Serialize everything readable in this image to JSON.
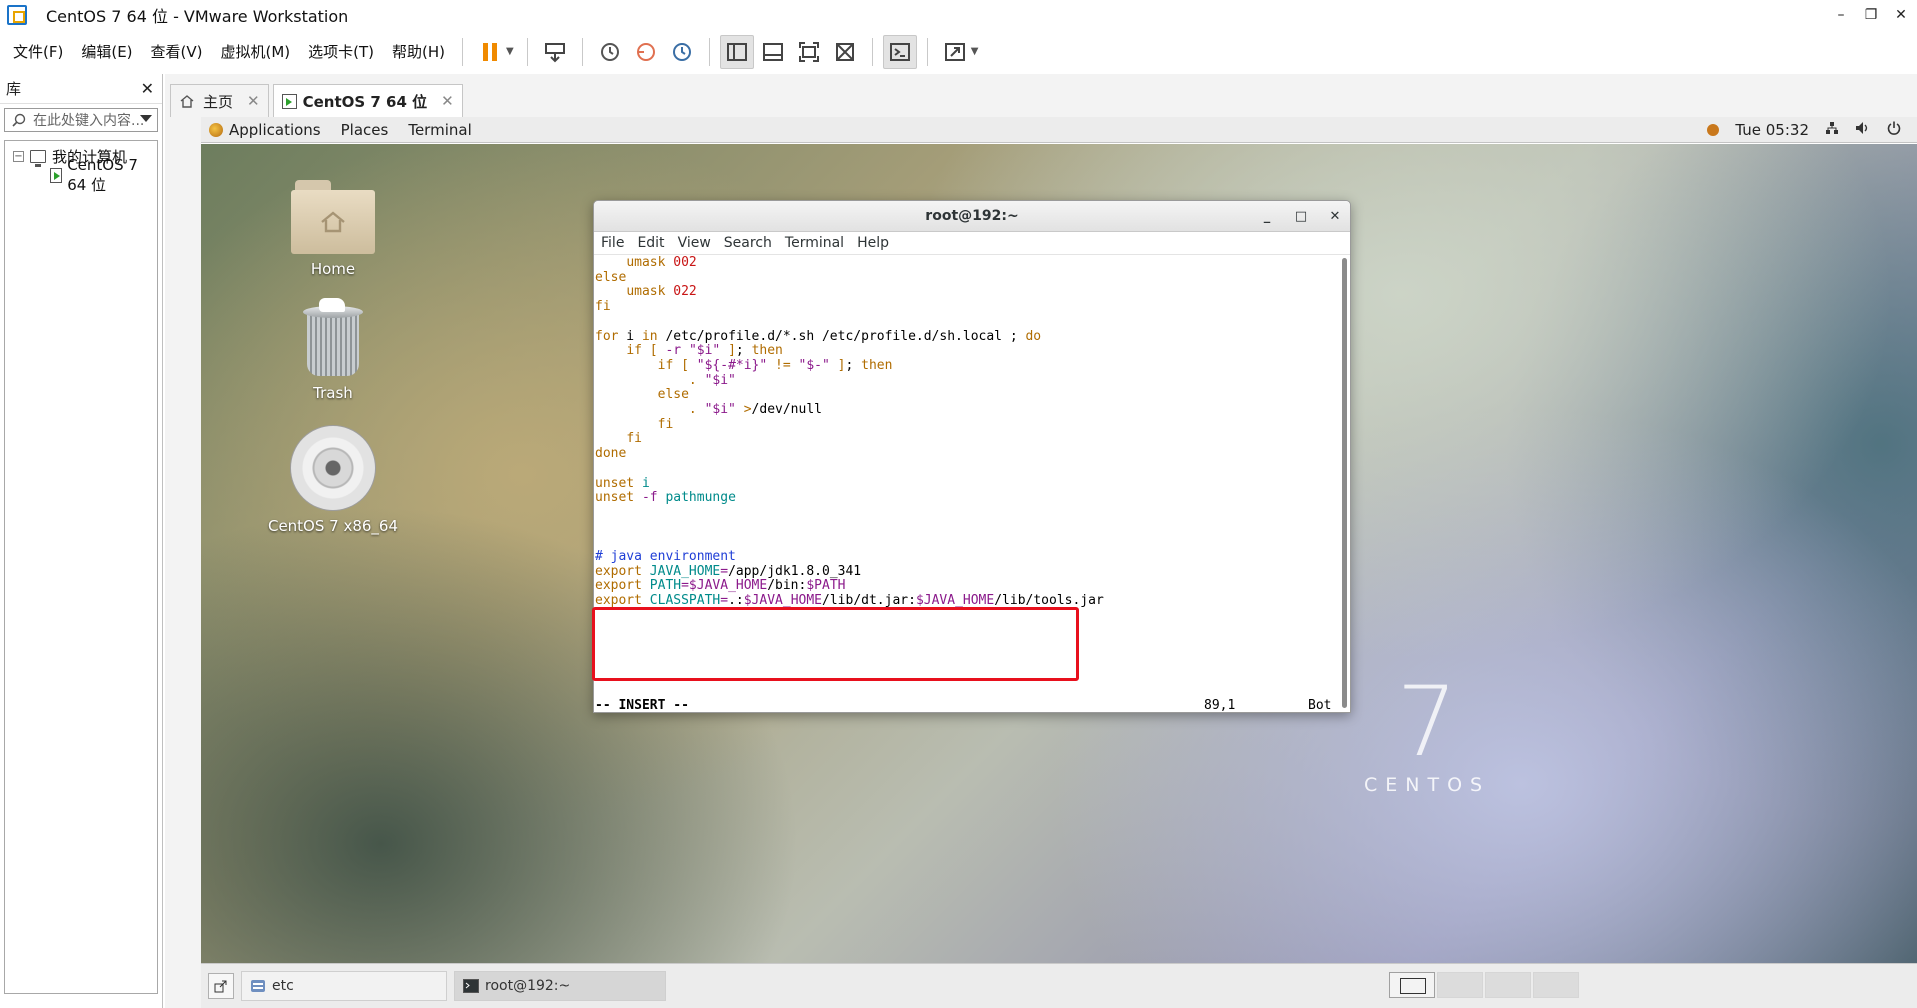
{
  "window": {
    "title": "CentOS 7 64 位 - VMware Workstation",
    "minimize": "–",
    "restore": "❐",
    "close": "✕"
  },
  "menu": {
    "items": [
      "文件(F)",
      "编辑(E)",
      "查看(V)",
      "虚拟机(M)",
      "选项卡(T)",
      "帮助(H)"
    ]
  },
  "library": {
    "title": "库",
    "close": "✕",
    "search_placeholder": "在此处键入内容...",
    "tree": {
      "root_label": "我的计算机",
      "toggle": "−",
      "vm_label": "CentOS 7 64 位"
    }
  },
  "tabs": [
    {
      "label": "主页",
      "close": "✕"
    },
    {
      "label": "CentOS 7 64 位",
      "close": "✕"
    }
  ],
  "gnome_top": {
    "applications": "Applications",
    "places": "Places",
    "terminal": "Terminal",
    "clock": "Tue 05:32"
  },
  "desktop": {
    "icons": [
      {
        "label": "Home"
      },
      {
        "label": "Trash"
      },
      {
        "label": "CentOS 7 x86_64"
      }
    ],
    "brand_number": "7",
    "brand_word": "CENTOS"
  },
  "terminal": {
    "title": "root@192:~",
    "minimize": "_",
    "maximize": "□",
    "close": "✕",
    "menu": [
      "File",
      "Edit",
      "View",
      "Search",
      "Terminal",
      "Help"
    ],
    "status_mode": "-- INSERT --",
    "status_position": "89,1",
    "status_scroll": "Bot"
  },
  "taskbar": {
    "items": [
      {
        "label": "etc"
      },
      {
        "label": "root@192:~"
      }
    ]
  },
  "colors": {
    "highlight_border": "#e8101d",
    "vim_keyword": "#b06c00",
    "vim_number": "#c81414",
    "vim_string": "#8b1a8b",
    "vim_variable": "#008b8b",
    "vim_comment": "#1f3ed6"
  }
}
